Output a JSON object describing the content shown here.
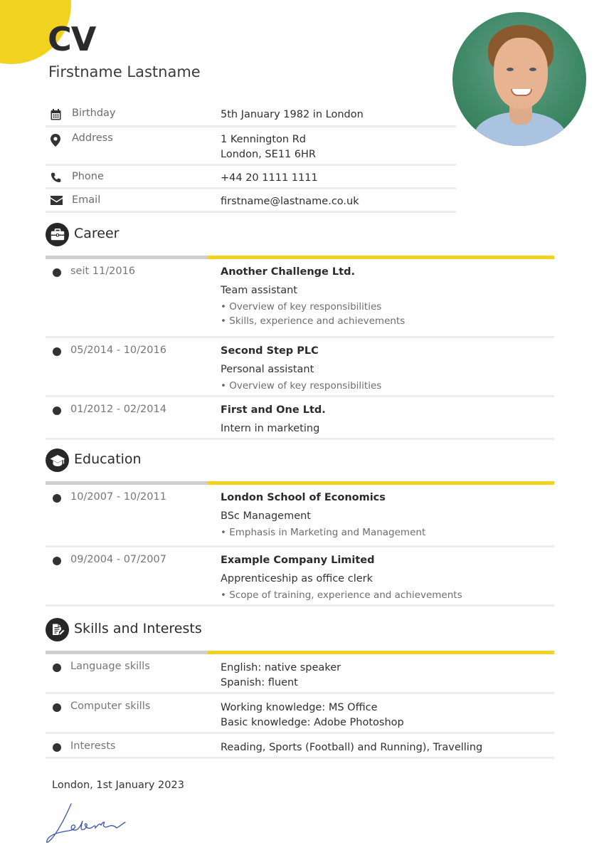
{
  "header": {
    "title": "CV",
    "name": "Firstname Lastname",
    "accent_color": "#f1d21f"
  },
  "personal_info": [
    {
      "icon": "calendar-icon",
      "label": "Birthday",
      "value_lines": [
        "5th January 1982 in London"
      ]
    },
    {
      "icon": "map-pin-icon",
      "label": "Address",
      "value_lines": [
        "1 Kennington Rd",
        "London, SE11 6HR"
      ]
    },
    {
      "icon": "phone-icon",
      "label": "Phone",
      "value_lines": [
        "+44 20 1111 1111"
      ]
    },
    {
      "icon": "envelope-icon",
      "label": "Email",
      "value_lines": [
        "firstname@lastname.co.uk"
      ]
    }
  ],
  "sections": {
    "career": {
      "icon": "briefcase-icon",
      "title": "Career",
      "entries": [
        {
          "date": "seit 11/2016",
          "org": "Another Challenge Ltd.",
          "role": "Team assistant",
          "bullets": [
            "• Overview of key responsibilities",
            "• Skills, experience and achievements"
          ]
        },
        {
          "date": "05/2014 - 10/2016",
          "org": "Second Step PLC",
          "role": "Personal assistant",
          "bullets": [
            "• Overview of key responsibilities"
          ]
        },
        {
          "date": "01/2012 - 02/2014",
          "org": "First and One Ltd.",
          "role": "Intern in marketing",
          "bullets": []
        }
      ]
    },
    "education": {
      "icon": "graduation-cap-icon",
      "title": "Education",
      "entries": [
        {
          "date": "10/2007 - 10/2011",
          "org": "London School of Economics",
          "role": "BSc Management",
          "bullets": [
            "• Emphasis in Marketing and Management"
          ]
        },
        {
          "date": "09/2004 - 07/2007",
          "org": "Example Company Limited",
          "role": "Apprenticeship as office clerk",
          "bullets": [
            "• Scope of training, experience and achievements"
          ]
        }
      ]
    },
    "skills": {
      "icon": "document-edit-icon",
      "title": "Skills and Interests",
      "entries": [
        {
          "label": "Language skills",
          "lines": [
            "English: native speaker",
            "Spanish: fluent"
          ]
        },
        {
          "label": "Computer skills",
          "lines": [
            "Working knowledge: MS Office",
            "Basic knowledge: Adobe Photoshop"
          ]
        },
        {
          "label": "Interests",
          "lines": [
            "Reading, Sports (Football) and Running), Travelling"
          ]
        }
      ]
    }
  },
  "footer": {
    "place_date": "London, 1st January 2023"
  }
}
